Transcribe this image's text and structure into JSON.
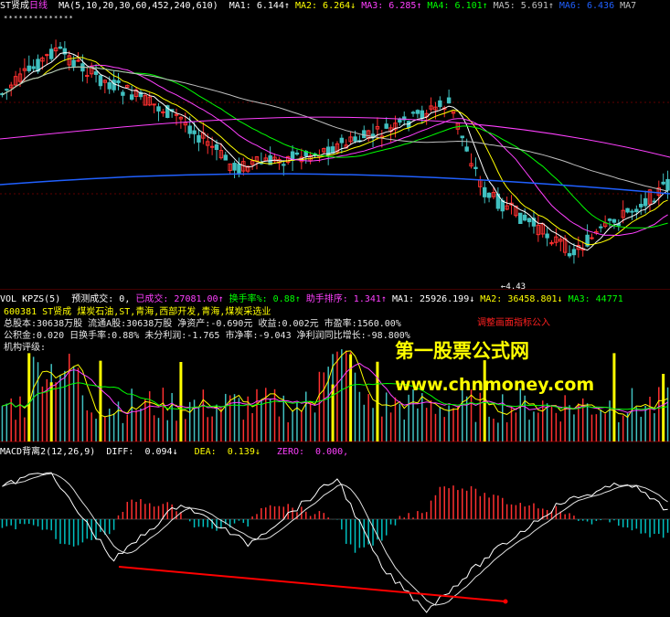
{
  "colors": {
    "up": "#ff3030",
    "down": "#40c0c0",
    "ma1": "#ffffff",
    "ma2": "#ffff00",
    "ma3": "#ff40ff",
    "ma4": "#00ff00",
    "ma5": "#c0c0c0",
    "ma6": "#2060ff",
    "macd_pos": "#ff3030",
    "macd_neg": "#00c0c0",
    "divergence": "#ff0000"
  },
  "price_panel": {
    "title": "ST贤成",
    "period": "日线",
    "ma_params": "MA(5,10,20,30,60,452,240,610)",
    "ma_values": [
      {
        "label": "MA1:",
        "value": "6.144",
        "arrow": "↑"
      },
      {
        "label": "MA2:",
        "value": "6.264",
        "arrow": "↓"
      },
      {
        "label": "MA3:",
        "value": "6.285",
        "arrow": "↑"
      },
      {
        "label": "MA4:",
        "value": "6.101",
        "arrow": "↑"
      },
      {
        "label": "MA5:",
        "value": "5.691",
        "arrow": "↑"
      },
      {
        "label": "MA6:",
        "value": "6.436",
        "arrow": ""
      },
      {
        "label": "MA7",
        "value": "",
        "arrow": ""
      }
    ],
    "low_label": "4.43"
  },
  "vol_panel": {
    "indicator": "VOL KPZS(5)",
    "items": [
      {
        "label": "预测成交:",
        "value": "0,"
      },
      {
        "label": "已成交:",
        "value": "27081.00↑"
      },
      {
        "label": "换手率%:",
        "value": "0.88↑"
      },
      {
        "label": "助手排序:",
        "value": "1.341↑"
      },
      {
        "label": "MA1:",
        "value": "25926.199↓"
      },
      {
        "label": "MA2:",
        "value": "36458.801↓"
      },
      {
        "label": "MA3:",
        "value": "44771"
      }
    ],
    "info_line1": "600381 ST贤成 煤炭石油,ST,青海,西部开发,青海,煤炭采选业",
    "info_line2": "总股本:30638万股 流通A股:30638万股  净资产:-0.690元  收益:0.002元  市盈率:1560.00%",
    "info_line3": "公积金:0.020  日换手率:0.88%  未分利润:-1.765  市净率:-9.043  净利润同比增长:-98.800%",
    "info_line4": "机构评级:",
    "red_tag": "调整画面指标公入"
  },
  "macd_panel": {
    "title": "MACD背离2(12,26,9)",
    "diff_label": "DIFF:",
    "diff_value": "0.094↓",
    "dea_label": "DEA:",
    "dea_value": "0.139↓",
    "zero_label": "ZERO:",
    "zero_value": "0.000,"
  },
  "watermark": {
    "title": "第一股票公式网",
    "url": "www.chnmoney.com"
  }
}
